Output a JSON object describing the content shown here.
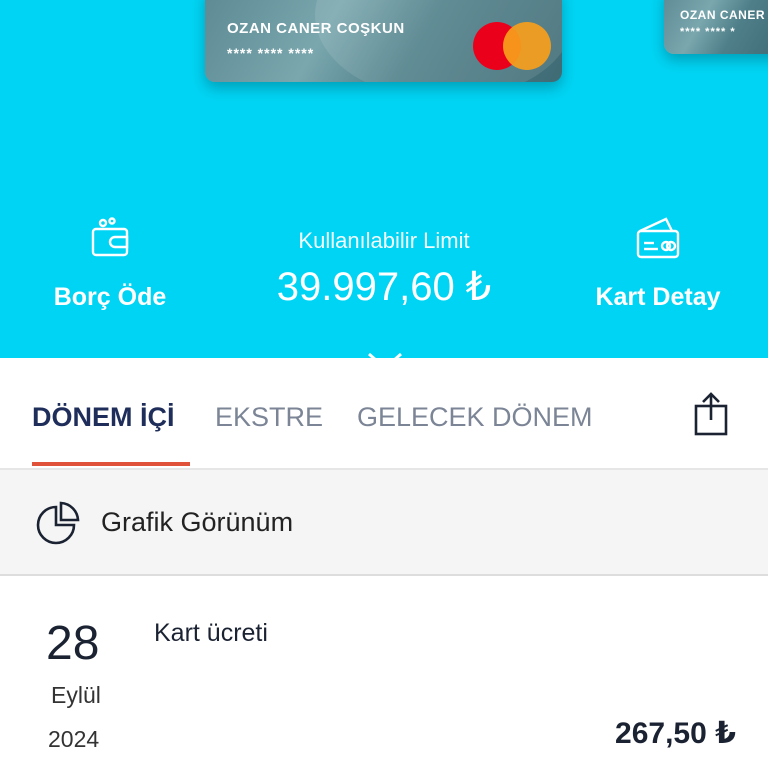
{
  "colors": {
    "brand_cyan": "#00d4f4",
    "accent_underline": "#e0533a",
    "active_tab": "#1e2d5a",
    "inactive_tab": "#7b8596"
  },
  "cards": [
    {
      "holder": "OZAN CANER COŞKUN",
      "masked_number": "**** **** ****",
      "brand_icon": "mastercard-logo"
    },
    {
      "holder": "OZAN CANER",
      "masked_number": "**** **** *"
    }
  ],
  "actions": {
    "pay_debt": {
      "label": "Borç Öde",
      "icon": "wallet-icon"
    },
    "card_detail": {
      "label": "Kart Detay",
      "icon": "card-detail-icon"
    }
  },
  "limit": {
    "caption": "Kullanılabilir Limit",
    "amount": "39.997,60 ₺"
  },
  "expand_icon": "chevron-down-icon",
  "tabs": [
    {
      "label": "DÖNEM İÇİ",
      "active": true
    },
    {
      "label": "EKSTRE",
      "active": false
    },
    {
      "label": "GELECEK DÖNEM",
      "active": false
    }
  ],
  "share_icon": "share-icon",
  "chart_view": {
    "label": "Grafik Görünüm",
    "icon": "pie-chart-icon"
  },
  "transactions": [
    {
      "day": "28",
      "month": "Eylül",
      "year": "2024",
      "description": "Kart ücreti",
      "amount": "267,50 ₺"
    }
  ]
}
